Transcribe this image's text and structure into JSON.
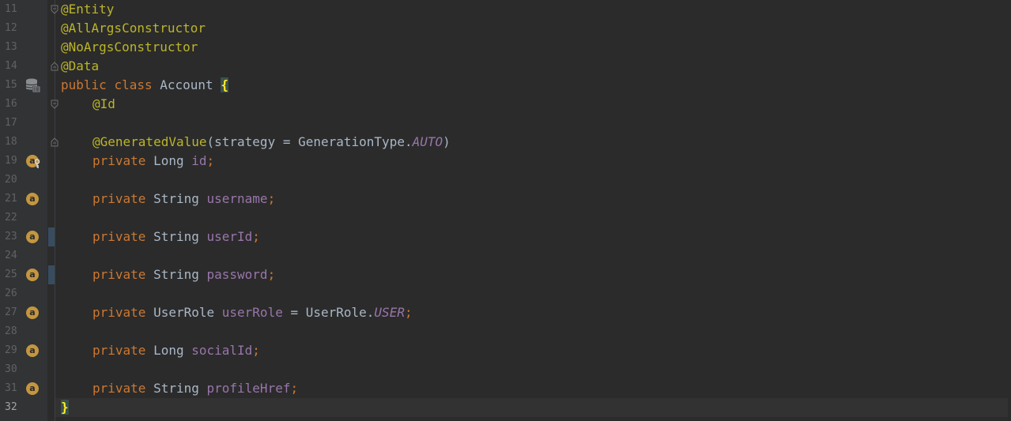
{
  "editor": {
    "language": "Java",
    "colors": {
      "background": "#2b2b2b",
      "gutter": "#313335",
      "keyword": "#cc7832",
      "annotation": "#bbb529",
      "field": "#9876aa",
      "text": "#a9b7c6",
      "badge": "#c4963f"
    },
    "lines": [
      {
        "num": "11",
        "t": [
          "@Entity"
        ]
      },
      {
        "num": "12",
        "t": [
          "@AllArgsConstructor"
        ]
      },
      {
        "num": "13",
        "t": [
          "@NoArgsConstructor"
        ]
      },
      {
        "num": "14",
        "t": [
          "@Data"
        ]
      },
      {
        "num": "15",
        "t": [
          "public",
          " ",
          "class",
          " Account ",
          "{"
        ]
      },
      {
        "num": "16",
        "t": [
          "@Id"
        ]
      },
      {
        "num": "17",
        "t": []
      },
      {
        "num": "18",
        "t": [
          "@GeneratedValue",
          "(strategy = GenerationType.",
          "AUTO",
          ")"
        ]
      },
      {
        "num": "19",
        "t": [
          "private",
          " Long ",
          "id",
          ";"
        ]
      },
      {
        "num": "20",
        "t": []
      },
      {
        "num": "21",
        "t": [
          "private",
          " String ",
          "username",
          ";"
        ]
      },
      {
        "num": "22",
        "t": []
      },
      {
        "num": "23",
        "t": [
          "private",
          " String ",
          "userId",
          ";"
        ]
      },
      {
        "num": "24",
        "t": []
      },
      {
        "num": "25",
        "t": [
          "private",
          " String ",
          "password",
          ";"
        ]
      },
      {
        "num": "26",
        "t": []
      },
      {
        "num": "27",
        "t": [
          "private",
          " UserRole ",
          "userRole",
          " = UserRole.",
          "USER",
          ";"
        ]
      },
      {
        "num": "28",
        "t": []
      },
      {
        "num": "29",
        "t": [
          "private",
          " Long ",
          "socialId",
          ";"
        ]
      },
      {
        "num": "30",
        "t": []
      },
      {
        "num": "31",
        "t": [
          "private",
          " String ",
          "profileHref",
          ";"
        ]
      },
      {
        "num": "32",
        "t": [
          "}"
        ]
      }
    ],
    "gutter_icons": {
      "15": "database-entity-icon",
      "19": "field-id-key-icon",
      "21": "field-icon",
      "23": "field-icon",
      "25": "field-icon",
      "27": "field-icon",
      "29": "field-icon",
      "31": "field-icon"
    },
    "badge_glyph": "a",
    "current_line": "32"
  }
}
